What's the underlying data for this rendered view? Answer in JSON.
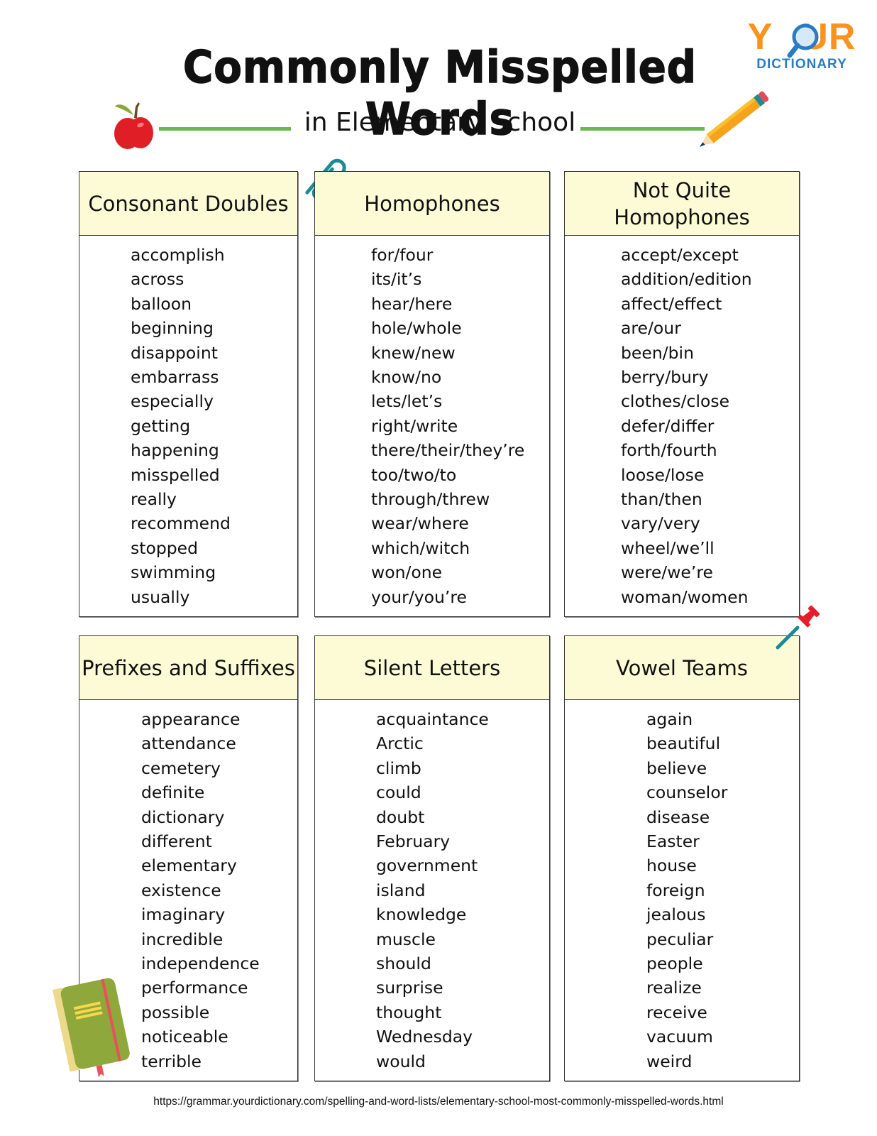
{
  "header": {
    "title": "Commonly Misspelled Words",
    "subtitle": "in Elementary School"
  },
  "logo": {
    "line1_left": "Y",
    "line1_right": "UR",
    "line2": "DICTIONARY"
  },
  "colors": {
    "header_fill": "#fdfbd5",
    "rule_green": "#6ab74c",
    "logo_orange": "#f7931e",
    "logo_blue": "#2a7bc4"
  },
  "sections": [
    {
      "title": "Consonant Doubles",
      "words": [
        "accomplish",
        "across",
        "balloon",
        "beginning",
        "disappoint",
        "embarrass",
        "especially",
        "getting",
        "happening",
        "misspelled",
        "really",
        "recommend",
        "stopped",
        "swimming",
        "usually"
      ]
    },
    {
      "title": "Homophones",
      "words": [
        "for/four",
        "its/it’s",
        "hear/here",
        "hole/whole",
        "knew/new",
        "know/no",
        "lets/let’s",
        "right/write",
        "there/their/they’re",
        "too/two/to",
        "through/threw",
        "wear/where",
        "which/witch",
        "won/one",
        "your/you’re"
      ]
    },
    {
      "title": "Not Quite Homophones",
      "words": [
        "accept/except",
        "addition/edition",
        "affect/effect",
        "are/our",
        "been/bin",
        "berry/bury",
        "clothes/close",
        "defer/differ",
        "forth/fourth",
        "loose/lose",
        "than/then",
        "vary/very",
        "wheel/we’ll",
        "were/we’re",
        "woman/women"
      ]
    },
    {
      "title": "Prefixes and Suffixes",
      "words": [
        "appearance",
        "attendance",
        "cemetery",
        "definite",
        "dictionary",
        "different",
        "elementary",
        "existence",
        "imaginary",
        "incredible",
        "independence",
        "performance",
        "possible",
        "noticeable",
        "terrible"
      ]
    },
    {
      "title": "Silent Letters",
      "words": [
        "acquaintance",
        "Arctic",
        "climb",
        "could",
        "doubt",
        "February",
        "government",
        "island",
        "knowledge",
        "muscle",
        "should",
        "surprise",
        "thought",
        "Wednesday",
        "would"
      ]
    },
    {
      "title": "Vowel Teams",
      "words": [
        "again",
        "beautiful",
        "believe",
        "counselor",
        "disease",
        "Easter",
        "house",
        "foreign",
        "jealous",
        "peculiar",
        "people",
        "realize",
        "receive",
        "vacuum",
        "weird"
      ]
    }
  ],
  "footer": {
    "url": "https://grammar.yourdictionary.com/spelling-and-word-lists/elementary-school-most-commonly-misspelled-words.html"
  }
}
